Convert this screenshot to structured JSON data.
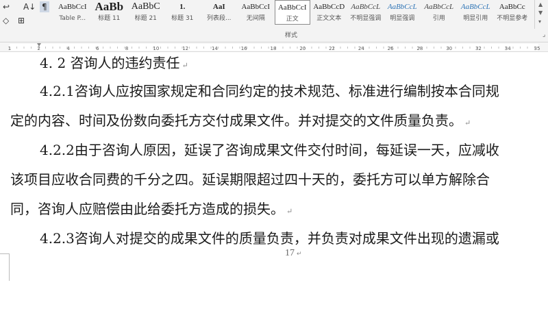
{
  "ribbon": {
    "left_tools": [
      {
        "icon": "clear-format-icon",
        "glyph": "↩"
      },
      {
        "icon": "sort-icon",
        "glyph": "A↓"
      },
      {
        "icon": "show-marks-icon",
        "glyph": "¶"
      },
      {
        "icon": "shading-icon",
        "glyph": "◇"
      },
      {
        "icon": "borders-icon",
        "glyph": "⊞"
      }
    ],
    "styles": [
      {
        "preview": "AaBbCcI",
        "name": "Table P..."
      },
      {
        "preview": "AaBb",
        "name": "标题 11"
      },
      {
        "preview": "AaBbC",
        "name": "标题 21"
      },
      {
        "preview": "1.",
        "name": "标题 31"
      },
      {
        "preview": "AaI",
        "name": "列表段..."
      },
      {
        "preview": "AaBbCcI",
        "name": "无间隔"
      },
      {
        "preview": "AaBbCcI",
        "name": "正文",
        "selected": true
      },
      {
        "preview": "AaBbCcD",
        "name": "正文文本"
      },
      {
        "preview": "AaBbCcL",
        "name": "不明显强调"
      },
      {
        "preview": "AaBbCcL",
        "name": "明显强调"
      },
      {
        "preview": "AaBbCcL",
        "name": "引用"
      },
      {
        "preview": "AaBbCcL",
        "name": "明显引用"
      },
      {
        "preview": "AaBbCc",
        "name": "不明显参考"
      }
    ],
    "group_label": "样式"
  },
  "ruler": {
    "numbers": [
      "1",
      "2",
      "4",
      "6",
      "8",
      "10",
      "12",
      "14",
      "16",
      "18",
      "20",
      "22",
      "24",
      "26",
      "28",
      "30",
      "32",
      "34",
      "35"
    ]
  },
  "document": {
    "lines": [
      "4. 2 咨询人的违约责任",
      "4.2.1咨询人应按国家规定和合同约定的技术规范、标准进行编制按本合同规",
      "定的内容、时间及份数向委托方交付成果文件。并对提交的文件质量负责。",
      "4.2.2由于咨询人原因，延误了咨询成果文件交付时间，每延误一天，应减收",
      "该项目应收合同费的千分之四。延误期限超过四十天的，委托方可以单方解除合",
      "同，咨询人应赔偿由此给委托方造成的损失。",
      "4.2.3咨询人对提交的成果文件的质量负责，并负责对成果文件出现的遗漏或"
    ],
    "paragraph_mark": "↵",
    "page_number": "17"
  }
}
